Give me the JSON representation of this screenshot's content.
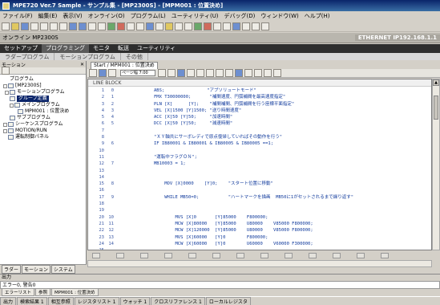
{
  "window": {
    "title": "MPE720 Ver.7 Sample - サンプル集 - [MP2300S] - [MPM001 : 位置決め]"
  },
  "menu": [
    "ファイル(F)",
    "編集(E)",
    "表示(V)",
    "オンライン(O)",
    "プログラム(L)",
    "ユーティリティ(U)",
    "デバッグ(D)",
    "ウィンドウ(W)",
    "ヘルプ(H)"
  ],
  "controller_bar": {
    "left": "オンライン   MP2300S",
    "right": "ETHERNET IP192.168.1.1"
  },
  "mode_tabs": [
    "セットアップ",
    "プログラミング",
    "モニタ",
    "転送",
    "ユーティリティ"
  ],
  "sub_tabs": [
    "ラダープログラム",
    "モーションプログラム",
    "その他"
  ],
  "left_panel": {
    "header": "モーション",
    "tree": [
      {
        "label": "プログラム",
        "indent": 0,
        "selected": false
      },
      {
        "label": "[MP2300S]",
        "indent": 0,
        "selected": false
      },
      {
        "label": "モーションプログラム",
        "indent": 1,
        "selected": false
      },
      {
        "label": "グループ定義",
        "indent": 1,
        "selected": true
      },
      {
        "label": "メインプログラム",
        "indent": 1,
        "selected": false
      },
      {
        "label": "MPM001 : 位置決め",
        "indent": 3,
        "selected": false
      },
      {
        "label": "サブプログラム",
        "indent": 1,
        "selected": false
      },
      {
        "label": "シーケンスプログラム",
        "indent": 0,
        "selected": false
      },
      {
        "label": "MOTION/RUN",
        "indent": 0,
        "selected": false
      },
      {
        "label": "運転制御パネル",
        "indent": 1,
        "selected": false
      }
    ],
    "tabs": [
      "ラダー",
      "モーション",
      "システム"
    ]
  },
  "editor": {
    "tab_label": "Start / MPM001 : 位置決め",
    "zoom_select": "ページ幅 7:00",
    "gutter_header": "LINE  BLOCK",
    "lines": [
      {
        "line": "1",
        "block": "0",
        "code": "ABS;                \"アブソリュートモード\""
      },
      {
        "line": "2",
        "block": "1",
        "code": "FMX T30000000;       \"補間速度、円弧補間を最高速度指定\""
      },
      {
        "line": "3",
        "block": "2",
        "code": "PLN [X]      [Y];    \"補間補間、円弧補間を行う座標平面指定\""
      },
      {
        "line": "4",
        "block": "3",
        "code": "VEL [X]1500 [Y]1500; \"送り時間速度\""
      },
      {
        "line": "5",
        "block": "4",
        "code": "ACC [X]50 [Y]50;     \"加速時間\""
      },
      {
        "line": "6",
        "block": "5",
        "code": "DCC [X]50 [Y]50;     \"減速時間\""
      },
      {
        "line": "7",
        "block": "",
        "code": ""
      },
      {
        "line": "8",
        "block": "",
        "code": "\"ＸＹ軸共にサーボレディで原点復帰していればその動作を行う\""
      },
      {
        "line": "9",
        "block": "6",
        "code": "IF IB80001 & IB80001 & IB80005 & IB80005 ==1;"
      },
      {
        "line": "10",
        "block": "",
        "code": ""
      },
      {
        "line": "11",
        "block": "",
        "code": "\"運転中フラグＯＮ\";"
      },
      {
        "line": "12",
        "block": "7",
        "code": "MB10003 = 1;"
      },
      {
        "line": "13",
        "block": "",
        "code": ""
      },
      {
        "line": "14",
        "block": "",
        "code": ""
      },
      {
        "line": "15",
        "block": "8",
        "code": "    MOV [X]0000    [Y]0;    \"スタート位置に移動\""
      },
      {
        "line": "16",
        "block": "",
        "code": ""
      },
      {
        "line": "17",
        "block": "9",
        "code": "    WHILE MB50=0;           \"ハートマークを描画  MB50に1がセットされるまで繰り返す\""
      },
      {
        "line": "18",
        "block": "",
        "code": ""
      },
      {
        "line": "19",
        "block": "",
        "code": ""
      },
      {
        "line": "20",
        "block": "10",
        "code": "        MVS [X]0       [Y]85000    F800000;"
      },
      {
        "line": "21",
        "block": "11",
        "code": "        MCW [X]80000   [Y]85000    U80000    V85000 F800000;"
      },
      {
        "line": "22",
        "block": "12",
        "code": "        MCW [X]120000  [Y]85000    U80000    V85000 F800000;"
      },
      {
        "line": "23",
        "block": "13",
        "code": "        MVS [X]60000   [Y]0        F800000;"
      },
      {
        "line": "24",
        "block": "14",
        "code": "        MCW [X]60000   [Y]0        U60000    V60000 F300000;"
      },
      {
        "line": "25",
        "block": "",
        "code": ""
      },
      {
        "line": "26",
        "block": "15",
        "code": "    WEND;"
      },
      {
        "line": "27",
        "block": "16",
        "code": "    MB50=0;"
      }
    ]
  },
  "output": {
    "title": "出力",
    "body": "エラー0, 警告0",
    "tabs": [
      "エラーリスト",
      "参照",
      "MPM001 : 位置決め"
    ]
  },
  "status_bar": [
    "出力",
    "検索結果 1",
    "相互参照",
    "レジスタリスト 1",
    "ウォッチ 1",
    "クロスリファレンス 1",
    "ローカルレジスタ"
  ]
}
